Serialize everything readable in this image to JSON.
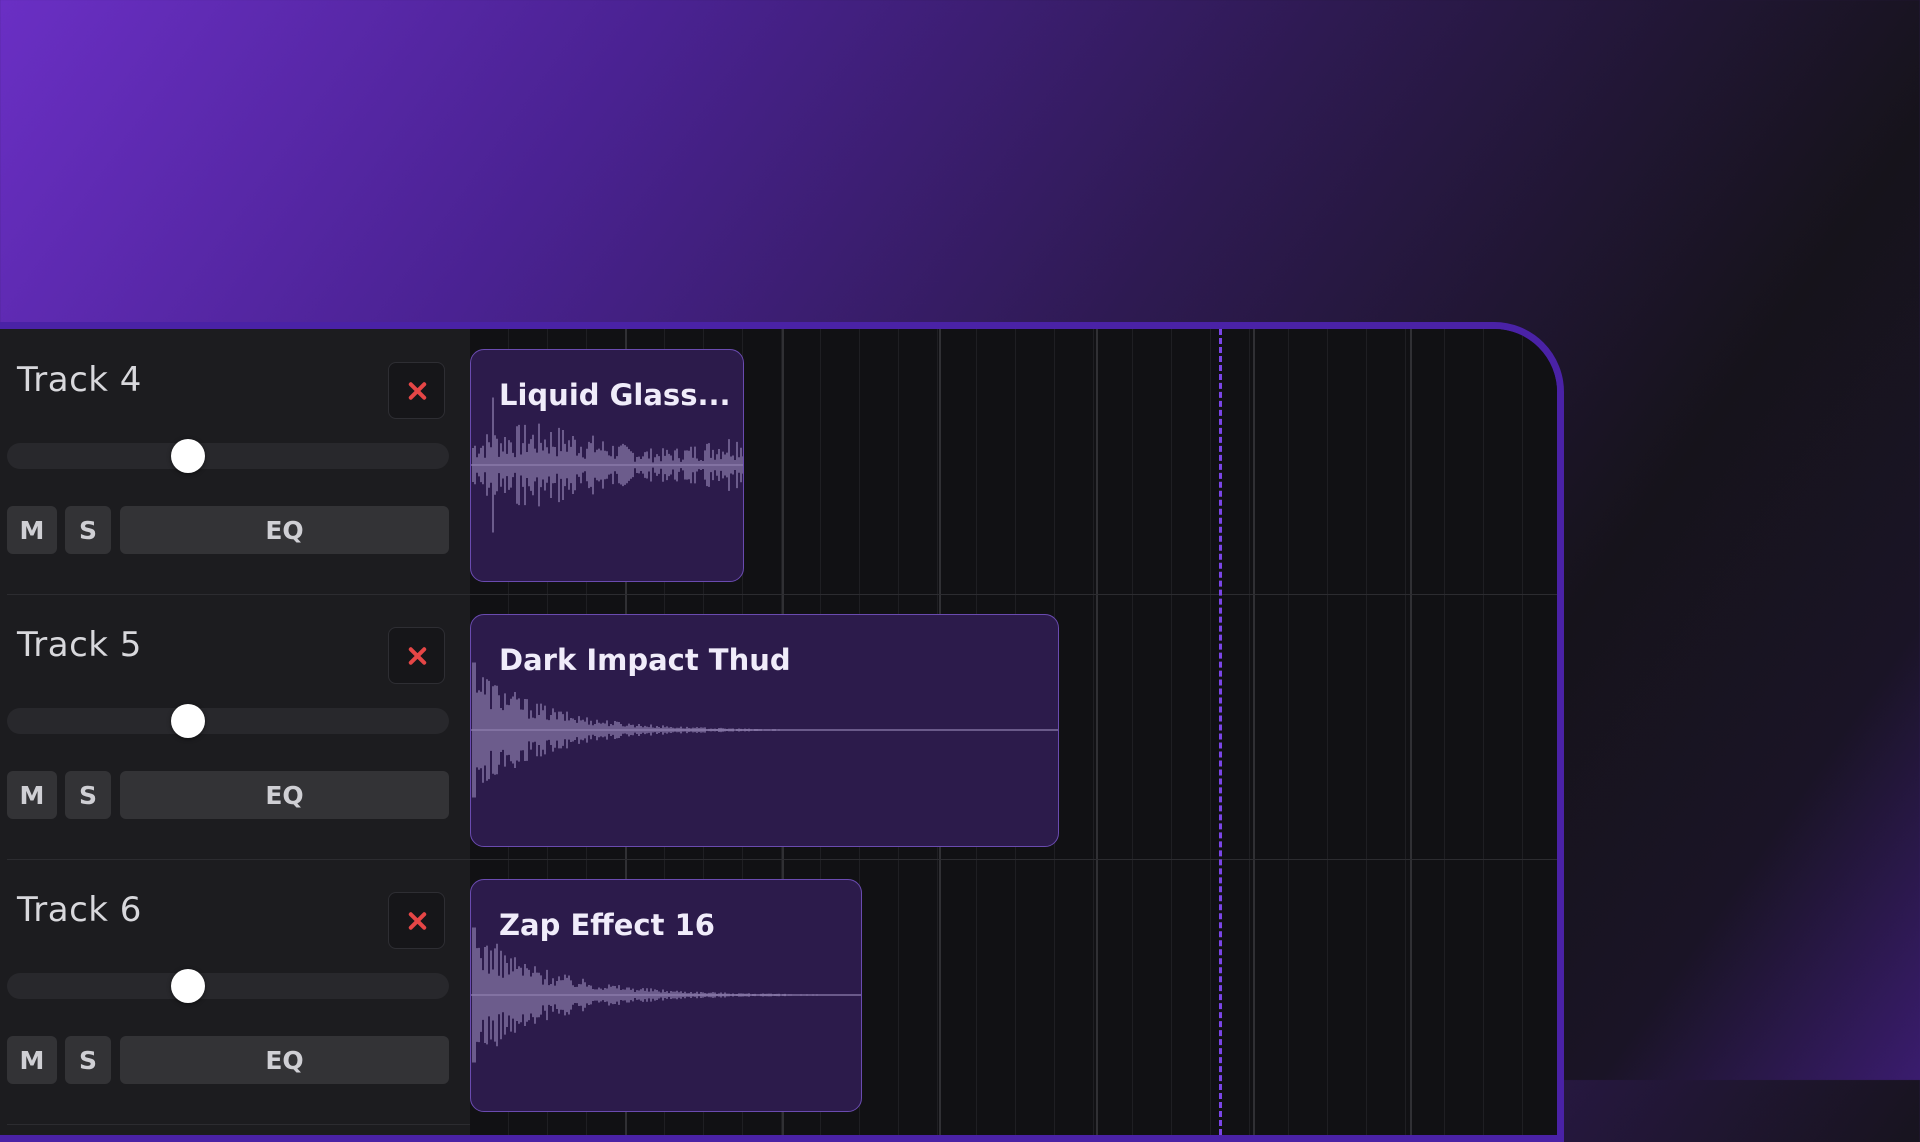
{
  "tracks": [
    {
      "name": "Track 4",
      "volume": 0.41,
      "mute_label": "M",
      "solo_label": "S",
      "eq_label": "EQ",
      "clip": {
        "title": "Liquid Glass..."
      }
    },
    {
      "name": "Track 5",
      "volume": 0.41,
      "mute_label": "M",
      "solo_label": "S",
      "eq_label": "EQ",
      "clip": {
        "title": "Dark Impact Thud"
      }
    },
    {
      "name": "Track 6",
      "volume": 0.41,
      "mute_label": "M",
      "solo_label": "S",
      "eq_label": "EQ",
      "clip": {
        "title": "Zap Effect 16"
      }
    }
  ],
  "icons": {
    "delete": "close-icon"
  },
  "colors": {
    "accent": "#7a45e6",
    "delete": "#e54646",
    "clip_fill": "#2c1b4b",
    "panel_border": "#4a22a6"
  }
}
